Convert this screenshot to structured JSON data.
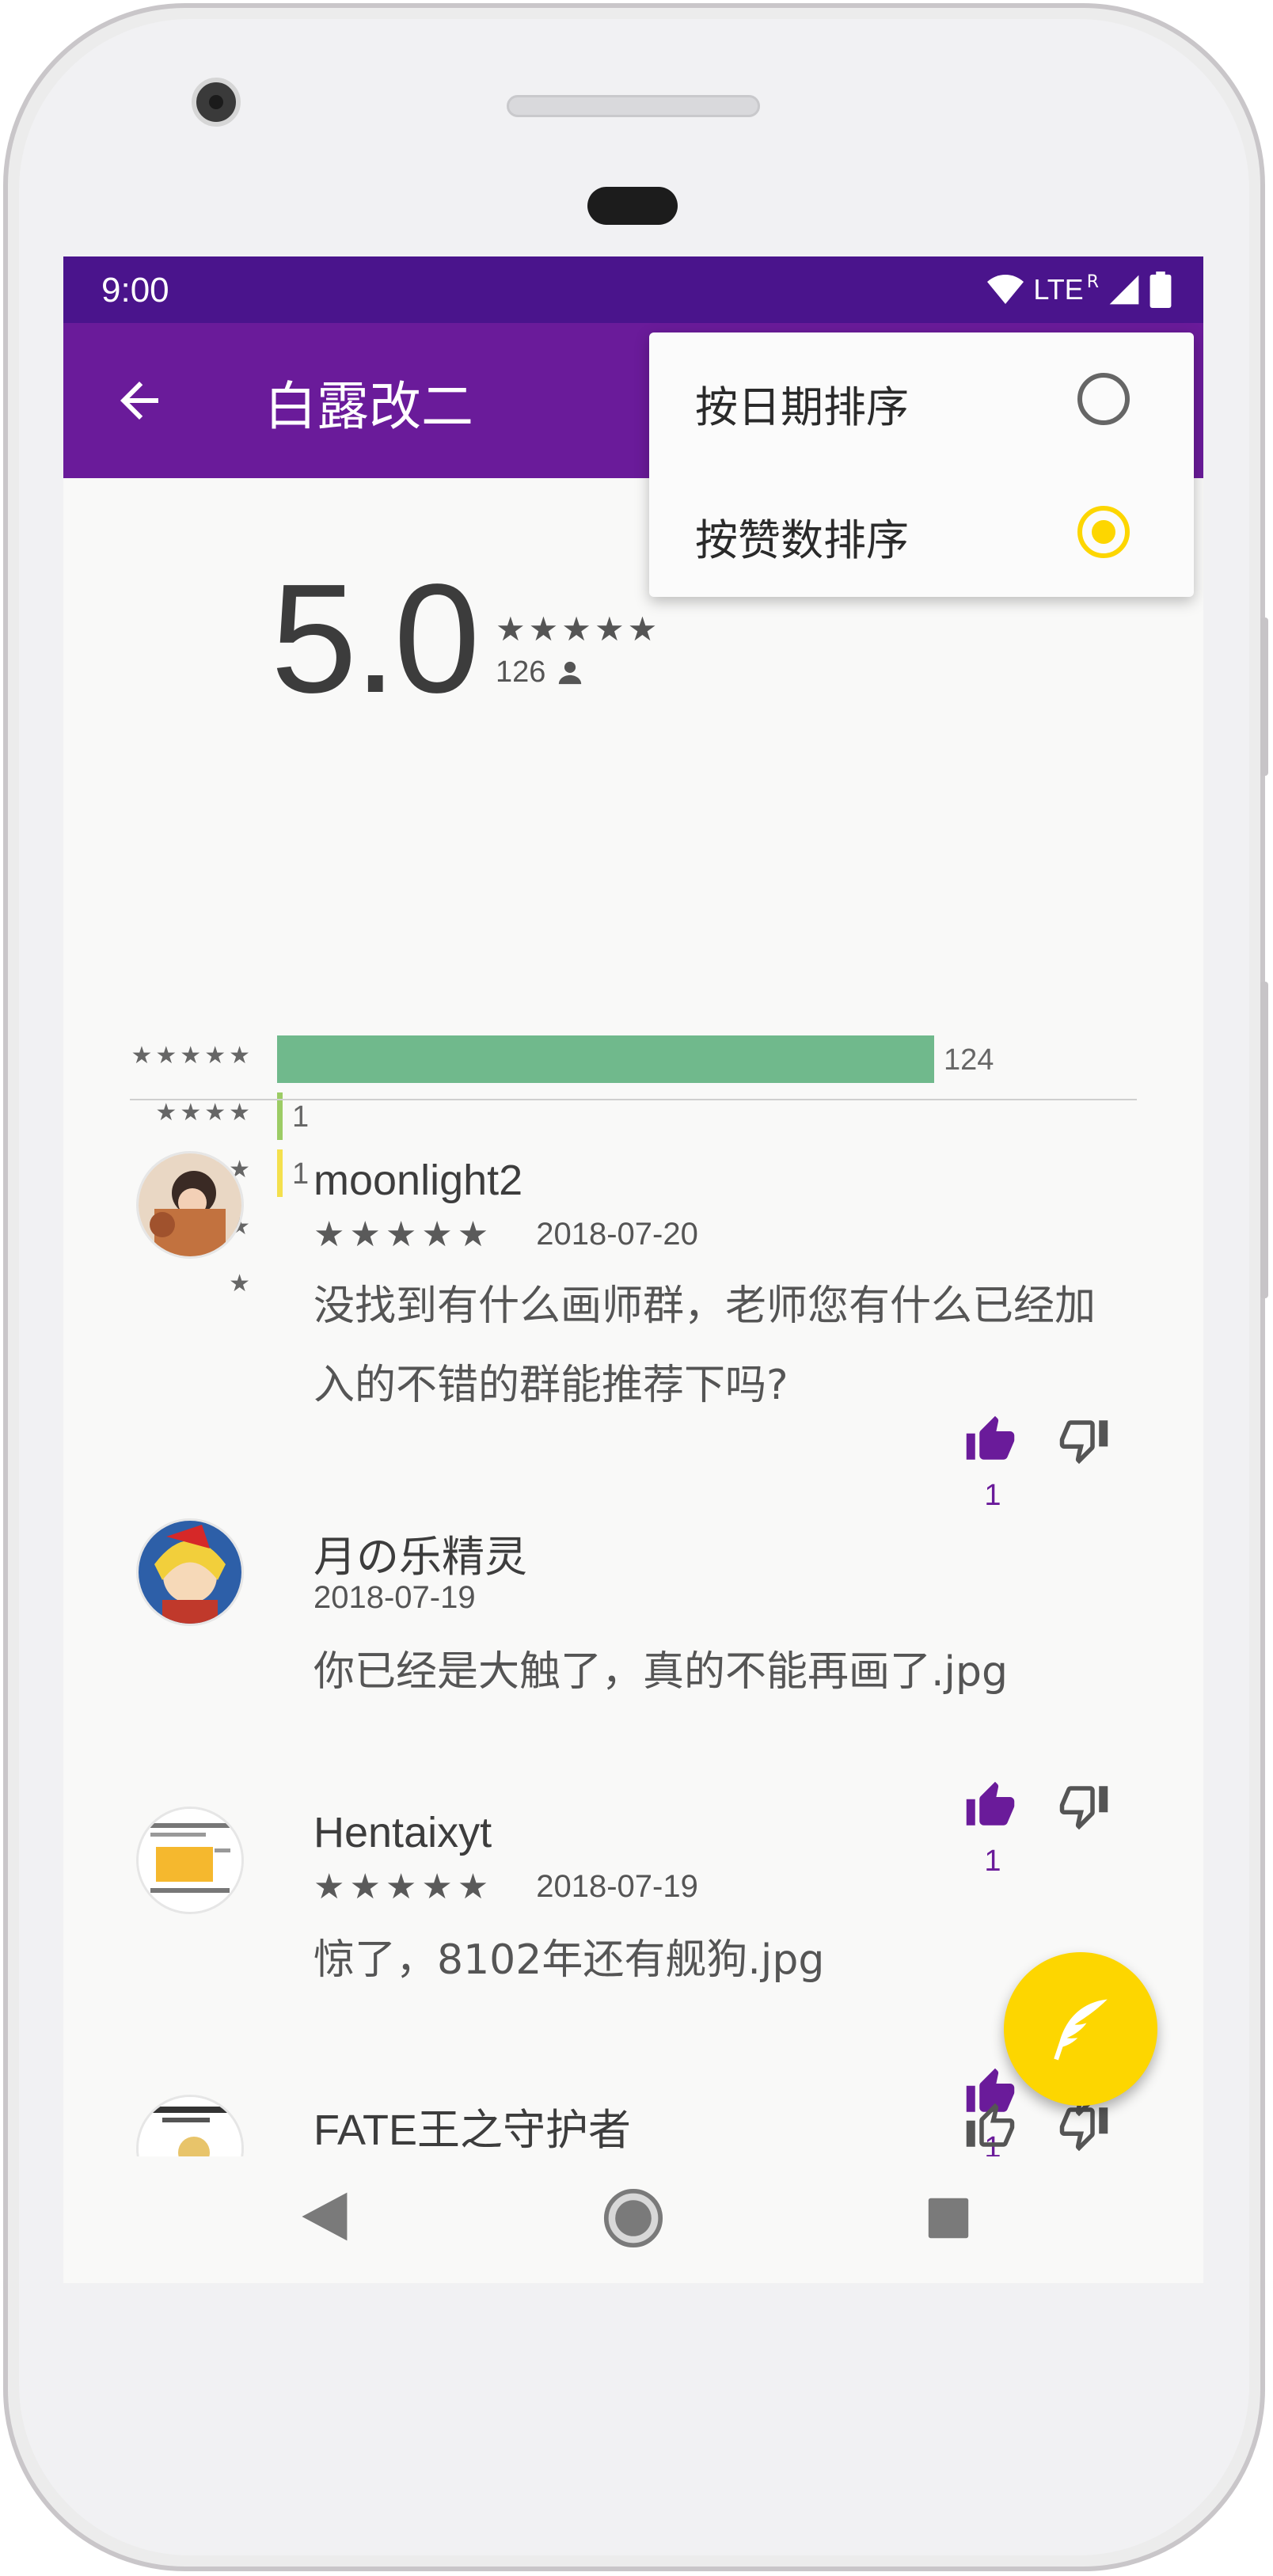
{
  "status_bar": {
    "time": "9:00",
    "network": "LTE",
    "roaming": "R"
  },
  "app_bar": {
    "title": "白露改二",
    "back_icon": "arrow-back-icon"
  },
  "sort_menu": {
    "items": [
      {
        "label": "按日期排序",
        "selected": false
      },
      {
        "label": "按赞数排序",
        "selected": true
      }
    ],
    "accent": "#fdd600"
  },
  "rating_summary": {
    "score": "5.0",
    "stars": "★★★★★",
    "count": "126",
    "distribution": [
      {
        "stars": "★★★★★",
        "count": "124",
        "value": 124,
        "color": "#70b98c"
      },
      {
        "stars": "★★★★",
        "count": "1",
        "value": 1,
        "color": "#9ccc65"
      },
      {
        "stars": "★★★",
        "count": "1",
        "value": 1,
        "color": "#f4e04d"
      },
      {
        "stars": "★★",
        "count": "",
        "value": 0,
        "color": "#f4a259"
      },
      {
        "stars": "★",
        "count": "",
        "value": 0,
        "color": "#ef6c57"
      }
    ]
  },
  "reviews": [
    {
      "name": "moonlight2",
      "stars": "★★★★★",
      "date": "2018-07-20",
      "text": "没找到有什么画师群，老师您有什么已经加入的不错的群能推荐下吗?",
      "likes": "1",
      "liked": true
    },
    {
      "name": "月の乐精灵",
      "stars": "",
      "date": "2018-07-19",
      "text": "你已经是大触了，真的不能再画了.jpg",
      "likes": "1",
      "liked": true
    },
    {
      "name": "Hentaixyt",
      "stars": "★★★★★",
      "date": "2018-07-19",
      "text": "惊了，8102年还有舰狗.jpg",
      "likes": "1",
      "liked": true
    },
    {
      "name": "FATE王之守护者",
      "stars": "",
      "date": "",
      "text": "",
      "likes": "",
      "liked": false
    }
  ],
  "fab": {
    "icon": "quill-icon"
  },
  "colors": {
    "primary": "#6a1b9a",
    "primary_dark": "#4a148c",
    "accent": "#fdd600"
  }
}
